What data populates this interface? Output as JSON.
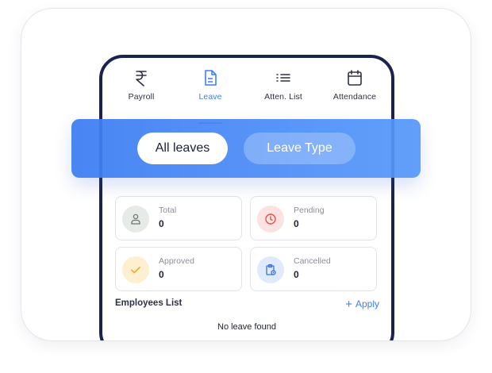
{
  "tabs": [
    {
      "label": "Payroll",
      "icon": "rupee-icon",
      "active": false
    },
    {
      "label": "Leave",
      "icon": "document-icon",
      "active": true
    },
    {
      "label": "Atten. List",
      "icon": "list-icon",
      "active": false
    },
    {
      "label": "Attendance",
      "icon": "calendar-icon",
      "active": false
    }
  ],
  "segment": {
    "all_leaves": "All leaves",
    "leave_type": "Leave Type"
  },
  "stats": [
    {
      "title": "Total",
      "value": "0",
      "icon": "user-icon",
      "color": "#e6ebe7"
    },
    {
      "title": "Pending",
      "value": "0",
      "icon": "clock-icon",
      "color": "#fde2e2"
    },
    {
      "title": "Approved",
      "value": "0",
      "icon": "check-icon",
      "color": "#fdefcf"
    },
    {
      "title": "Cancelled",
      "value": "0",
      "icon": "clipboard-icon",
      "color": "#dfeafc"
    }
  ],
  "employees": {
    "title": "Employees List",
    "apply_label": "Apply",
    "empty_message": "No leave found"
  },
  "colors": {
    "accent": "#3d7ef0",
    "frame": "#1c2250"
  }
}
